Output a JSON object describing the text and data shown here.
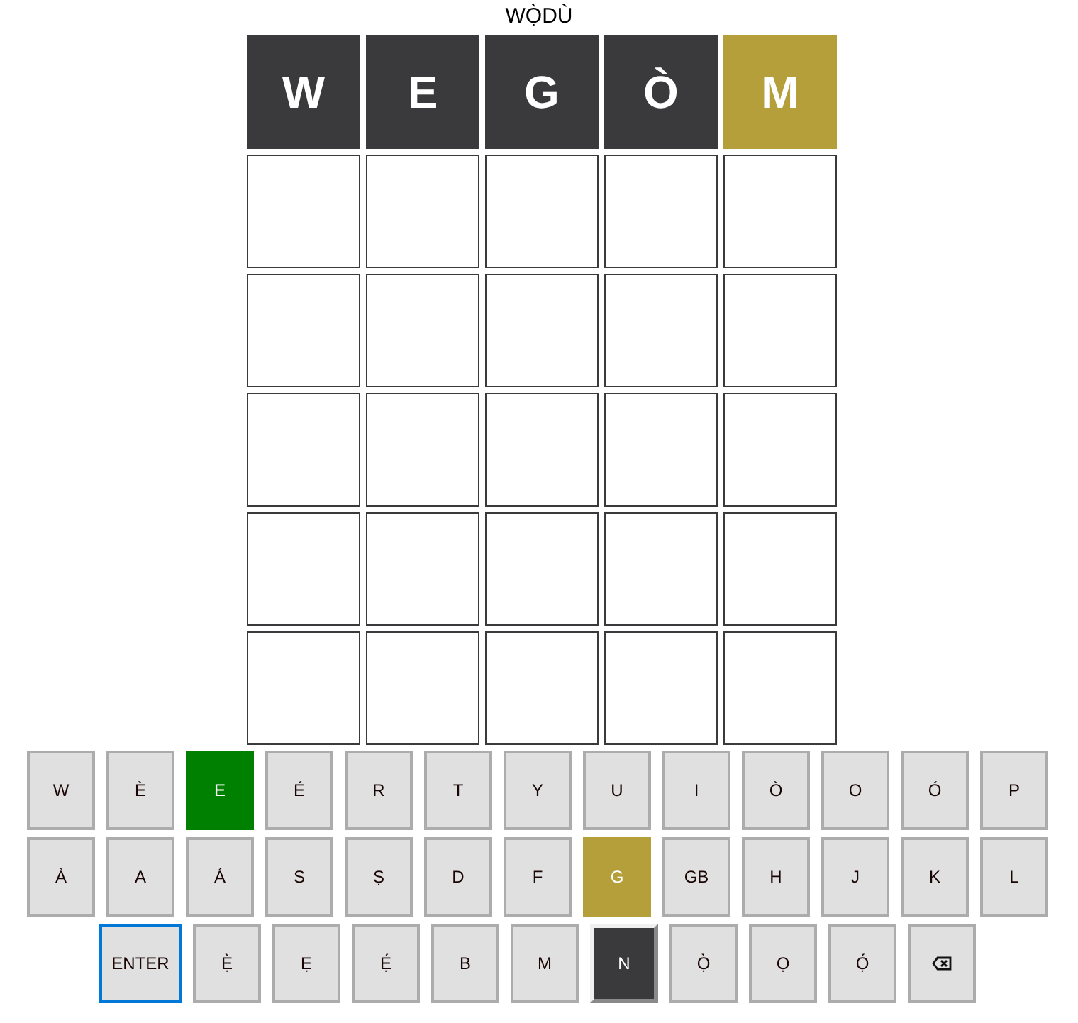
{
  "title": "WỌ̀DÙ",
  "board": [
    [
      {
        "letter": "W",
        "kind": "absent"
      },
      {
        "letter": "E",
        "kind": "absent"
      },
      {
        "letter": "G",
        "kind": "absent"
      },
      {
        "letter": "Ò",
        "kind": "absent"
      },
      {
        "letter": "M",
        "kind": "present"
      }
    ],
    [
      {
        "kind": "empty"
      },
      {
        "kind": "empty"
      },
      {
        "kind": "empty"
      },
      {
        "kind": "empty"
      },
      {
        "kind": "empty"
      }
    ],
    [
      {
        "kind": "empty"
      },
      {
        "kind": "empty"
      },
      {
        "kind": "empty"
      },
      {
        "kind": "empty"
      },
      {
        "kind": "empty"
      }
    ],
    [
      {
        "kind": "empty"
      },
      {
        "kind": "empty"
      },
      {
        "kind": "empty"
      },
      {
        "kind": "empty"
      },
      {
        "kind": "empty"
      }
    ],
    [
      {
        "kind": "empty"
      },
      {
        "kind": "empty"
      },
      {
        "kind": "empty"
      },
      {
        "kind": "empty"
      },
      {
        "kind": "empty"
      }
    ],
    [
      {
        "kind": "empty"
      },
      {
        "kind": "empty"
      },
      {
        "kind": "empty"
      },
      {
        "kind": "empty"
      },
      {
        "kind": "empty"
      }
    ]
  ],
  "keyboard": [
    [
      {
        "kind": "unused",
        "label": "W"
      },
      {
        "kind": "unused",
        "label": "È"
      },
      {
        "kind": "correct",
        "label": "E"
      },
      {
        "kind": "unused",
        "label": "É"
      },
      {
        "kind": "unused",
        "label": "R"
      },
      {
        "kind": "unused",
        "label": "T"
      },
      {
        "kind": "unused",
        "label": "Y"
      },
      {
        "kind": "unused",
        "label": "U"
      },
      {
        "kind": "unused",
        "label": "I"
      },
      {
        "kind": "unused",
        "label": "Ò"
      },
      {
        "kind": "unused",
        "label": "O"
      },
      {
        "kind": "unused",
        "label": "Ó"
      },
      {
        "kind": "unused",
        "label": "P"
      }
    ],
    [
      {
        "kind": "unused",
        "label": "À"
      },
      {
        "kind": "unused",
        "label": "A"
      },
      {
        "kind": "unused",
        "label": "Á"
      },
      {
        "kind": "unused",
        "label": "S"
      },
      {
        "kind": "unused",
        "label": "Ṣ"
      },
      {
        "kind": "unused",
        "label": "D"
      },
      {
        "kind": "unused",
        "label": "F"
      },
      {
        "kind": "present",
        "label": "G"
      },
      {
        "kind": "unused",
        "label": "GB"
      },
      {
        "kind": "unused",
        "label": "H"
      },
      {
        "kind": "unused",
        "label": "J"
      },
      {
        "kind": "unused",
        "label": "K"
      },
      {
        "kind": "unused",
        "label": "L"
      }
    ],
    [
      {
        "kind": "enter",
        "label": "ENTER",
        "focused": true
      },
      {
        "kind": "unused",
        "label": "Ẹ̀"
      },
      {
        "kind": "unused",
        "label": "Ẹ"
      },
      {
        "kind": "unused",
        "label": "Ẹ́"
      },
      {
        "kind": "unused",
        "label": "B"
      },
      {
        "kind": "unused",
        "label": "M"
      },
      {
        "kind": "absent",
        "label": "N"
      },
      {
        "kind": "unused",
        "label": "Ọ̀"
      },
      {
        "kind": "unused",
        "label": "Ọ"
      },
      {
        "kind": "unused",
        "label": "Ọ́"
      },
      {
        "kind": "backspace"
      }
    ]
  ]
}
